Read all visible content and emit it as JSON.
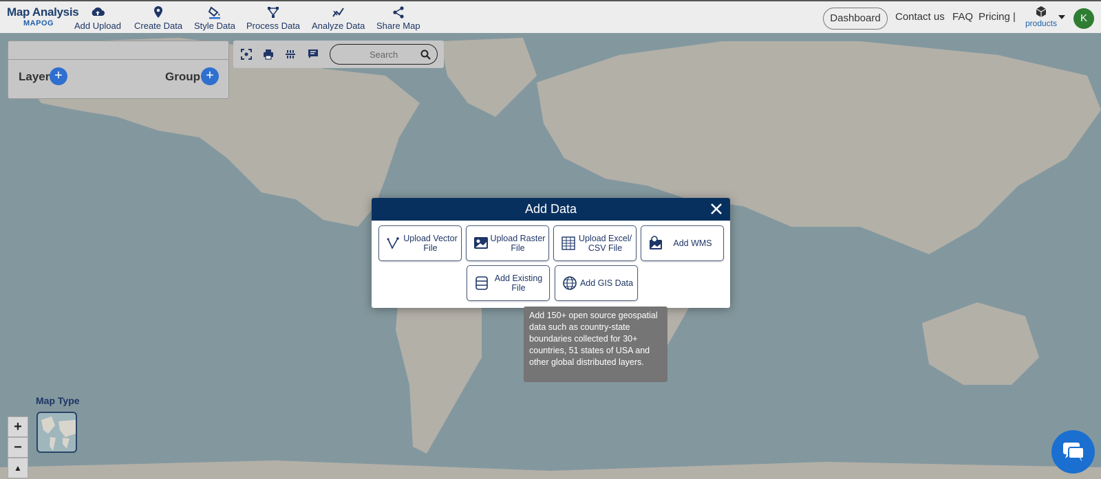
{
  "brand": {
    "title": "Map Analysis",
    "subtitle": "MAPOG"
  },
  "nav": [
    {
      "label": "Add Upload",
      "icon": "cloud-upload-icon"
    },
    {
      "label": "Create Data",
      "icon": "map-pin-icon"
    },
    {
      "label": "Style Data",
      "icon": "paint-bucket-icon"
    },
    {
      "label": "Process Data",
      "icon": "process-icon"
    },
    {
      "label": "Analyze Data",
      "icon": "analyze-icon"
    },
    {
      "label": "Share Map",
      "icon": "share-icon"
    }
  ],
  "right_nav": {
    "dashboard": "Dashboard",
    "contact": "Contact us",
    "faq": "FAQ",
    "pricing": "Pricing |",
    "products": "products",
    "avatar_letter": "K"
  },
  "layer_panel": {
    "layer_label": "Layer",
    "group_label": "Group"
  },
  "search": {
    "placeholder": "Search"
  },
  "map_type": {
    "label": "Map Type"
  },
  "zoom": {
    "in": "+",
    "out": "−",
    "north": "▲"
  },
  "modal": {
    "title": "Add Data",
    "options": [
      {
        "label": "Upload Vector File",
        "icon": "vector-icon"
      },
      {
        "label": "Upload Raster File",
        "icon": "raster-image-icon"
      },
      {
        "label": "Upload Excel/ CSV File",
        "icon": "table-icon"
      },
      {
        "label": "Add WMS",
        "icon": "wms-icon"
      },
      {
        "label": "Add Existing File",
        "icon": "database-icon"
      },
      {
        "label": "Add GIS Data",
        "icon": "globe-icon"
      }
    ]
  },
  "tooltip": {
    "text": "Add 150+ open source geospatial data such as country-state boundaries collected for 30+ countries, 51 states of USA and other global distributed layers."
  },
  "colors": {
    "header_navy": "#08305f",
    "accent_blue": "#2f6fd0",
    "avatar_green": "#2e7d32"
  }
}
